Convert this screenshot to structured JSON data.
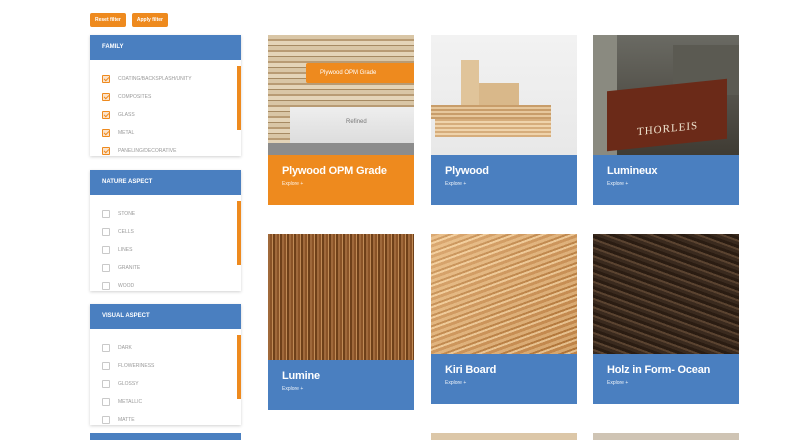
{
  "toolbar": {
    "reset_label": "Reset filter",
    "apply_label": "Apply filter"
  },
  "filters": [
    {
      "title": "Family",
      "options": [
        {
          "label": "Coating/backsplash/unity",
          "checked": true
        },
        {
          "label": "Composites",
          "checked": true
        },
        {
          "label": "Glass",
          "checked": true
        },
        {
          "label": "Metal",
          "checked": true
        },
        {
          "label": "Paneling/decorative",
          "checked": true
        }
      ]
    },
    {
      "title": "Nature aspect",
      "options": [
        {
          "label": "Stone",
          "checked": false
        },
        {
          "label": "Cells",
          "checked": false
        },
        {
          "label": "Lines",
          "checked": false
        },
        {
          "label": "Granite",
          "checked": false
        },
        {
          "label": "Wood",
          "checked": false
        }
      ]
    },
    {
      "title": "Visual aspect",
      "options": [
        {
          "label": "Dark",
          "checked": false
        },
        {
          "label": "Floweriness",
          "checked": false
        },
        {
          "label": "Glossy",
          "checked": false
        },
        {
          "label": "Metallic",
          "checked": false
        },
        {
          "label": "Matte",
          "checked": false
        }
      ]
    }
  ],
  "products": [
    {
      "title": "Plywood OPM Grade",
      "more": "Explore +",
      "hover_label": "Plywood OPM Grade",
      "image_text": "Refined",
      "accent": "#ee8a1e"
    },
    {
      "title": "Plywood",
      "more": "Explore +",
      "accent": "#4a7fc0"
    },
    {
      "title": "Lumineux",
      "more": "Explore +",
      "image_text": "THORLEIS",
      "accent": "#4a7fc0"
    },
    {
      "title": "Lumine",
      "more": "Explore +",
      "accent": "#4a7fc0"
    },
    {
      "title": "Kiri Board",
      "more": "Explore +",
      "accent": "#4a7fc0"
    },
    {
      "title": "Holz in Form- Ocean",
      "more": "Explore +",
      "accent": "#4a7fc0"
    }
  ],
  "colors": {
    "accent_orange": "#ee8a1e",
    "header_blue": "#4a7fc0"
  }
}
